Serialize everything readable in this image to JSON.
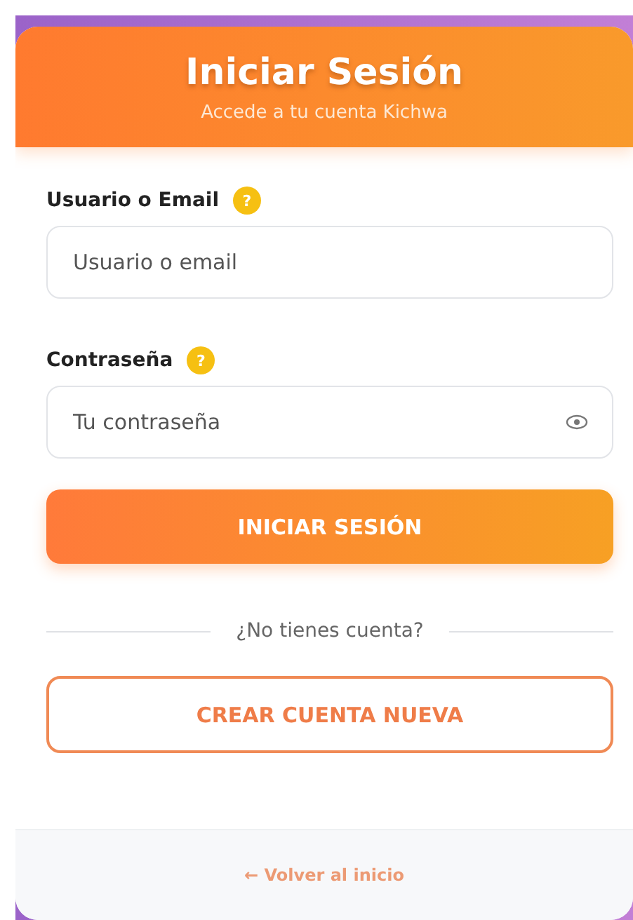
{
  "header": {
    "title": "Iniciar Sesión",
    "subtitle": "Accede a tu cuenta Kichwa"
  },
  "fields": [
    {
      "label": "Usuario o Email",
      "help": "?",
      "placeholder": "Usuario o email",
      "kind": "text"
    },
    {
      "label": "Contraseña",
      "help": "?",
      "placeholder": "Tu contraseña",
      "kind": "password"
    }
  ],
  "submit_button": "INICIAR SESIÓN",
  "divider_text": "¿No tienes cuenta?",
  "create_button": "CREAR CUENTA NUEVA",
  "footer_link": "← Volver al inicio"
}
